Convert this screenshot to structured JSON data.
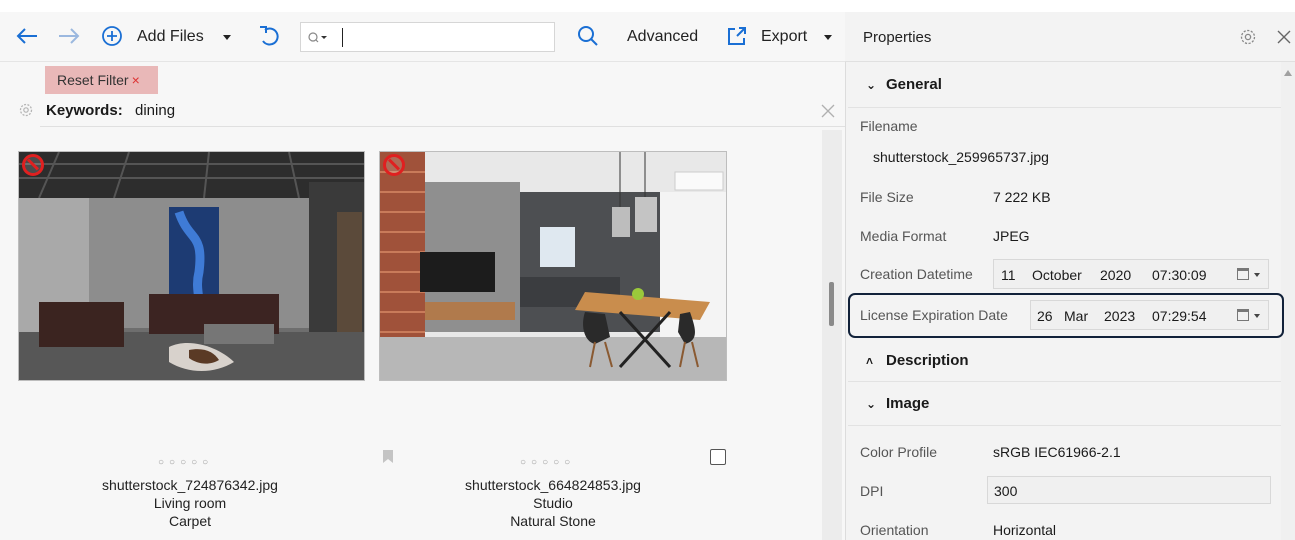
{
  "toolbar": {
    "back_icon": "arrow-left-icon",
    "forward_icon": "arrow-right-icon",
    "add_files_icon": "plus-circle-icon",
    "add_files_label": "Add Files",
    "undo_icon": "undo-icon",
    "search_icon": "magnifier-icon",
    "search_value": "",
    "advanced_label": "Advanced",
    "export_icon": "export-icon",
    "export_label": "Export"
  },
  "filter": {
    "reset_label": "Reset Filter",
    "reset_x": "×",
    "keywords_label": "Keywords:",
    "keywords_value": "dining"
  },
  "items": [
    {
      "filename": "shutterstock_724876342.jpg",
      "line2": "Living room",
      "line3": "Carpet",
      "rating_dots": "○○○○○"
    },
    {
      "filename": "shutterstock_664824853.jpg",
      "line2": "Studio",
      "line3": "Natural Stone",
      "rating_dots": "○○○○○"
    }
  ],
  "properties": {
    "title": "Properties",
    "general_title": "General",
    "filename_label": "Filename",
    "filename_value": "shutterstock_259965737.jpg",
    "filesize_label": "File Size",
    "filesize_value": "7 222 KB",
    "mediaformat_label": "Media Format",
    "mediaformat_value": "JPEG",
    "creation_label": "Creation Datetime",
    "creation_day": "11",
    "creation_month": "October",
    "creation_year": "2020",
    "creation_time": "07:30:09",
    "license_label": "License Expiration Date",
    "license_day": "26",
    "license_month": "Mar",
    "license_year": "2023",
    "license_time": "07:29:54",
    "description_title": "Description",
    "image_title": "Image",
    "colorprofile_label": "Color Profile",
    "colorprofile_value": "sRGB IEC61966-2.1",
    "dpi_label": "DPI",
    "dpi_value": "300",
    "orientation_label": "Orientation",
    "orientation_value": "Horizontal"
  },
  "colors": {
    "reset_filter_bg": "#e9b8b8",
    "highlight_border": "#12223a",
    "accent_blue": "#1a6fd4",
    "noentry_red": "#e02020"
  }
}
